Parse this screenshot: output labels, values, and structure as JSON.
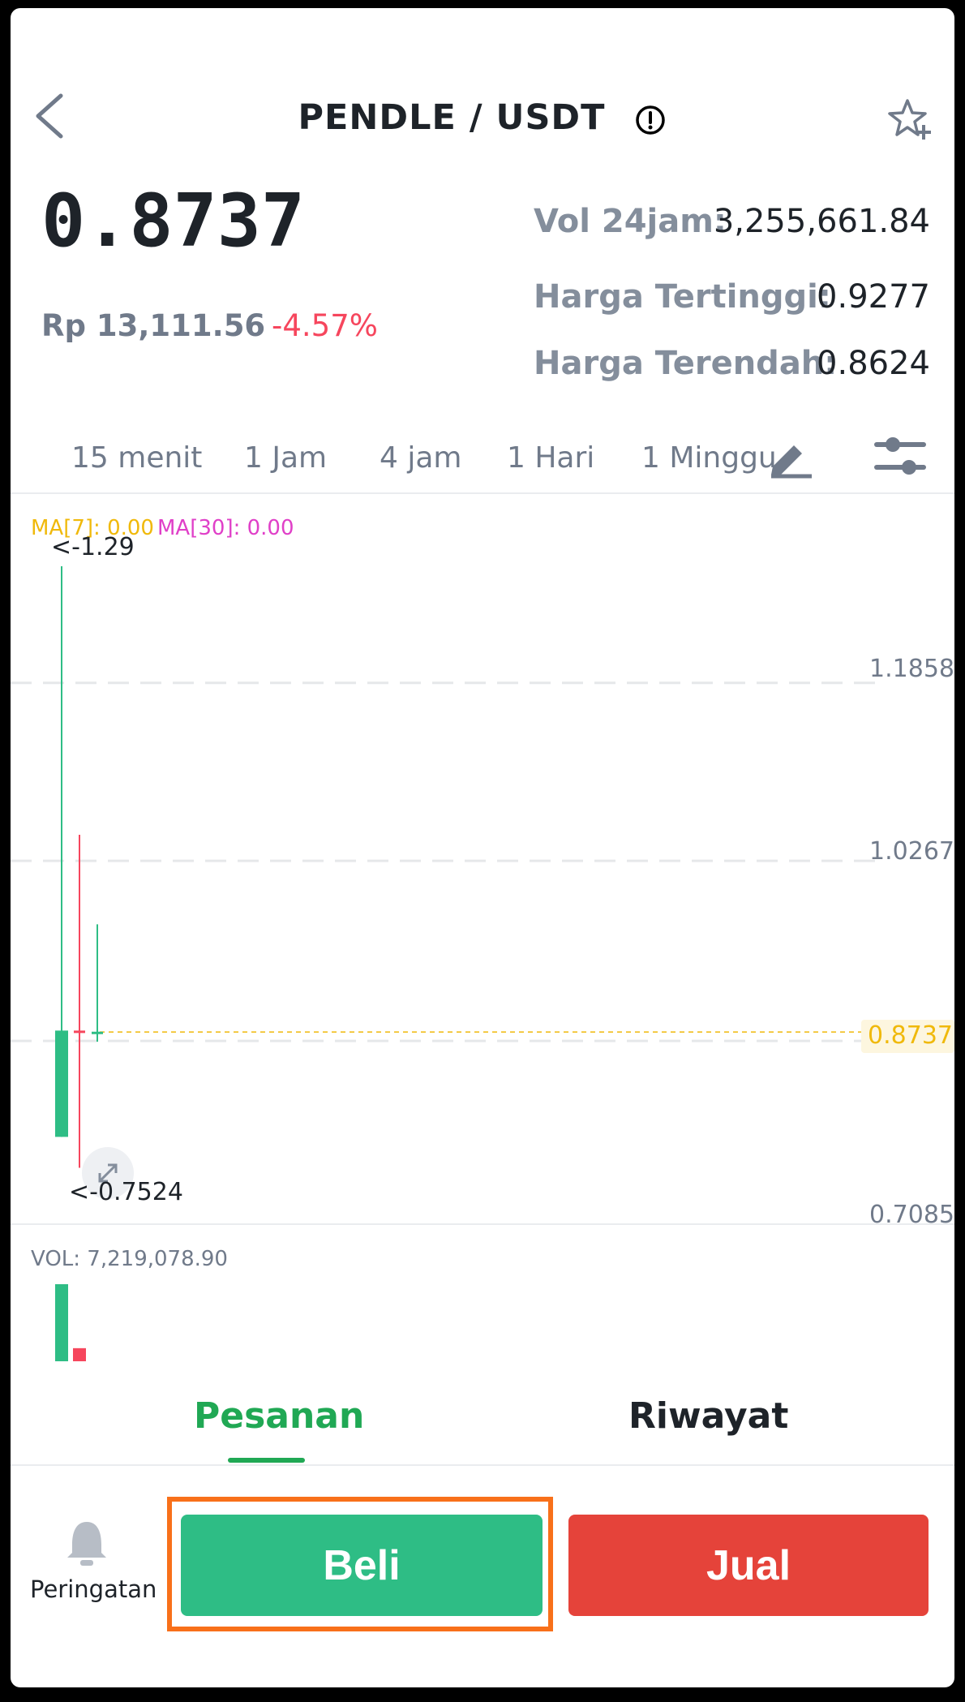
{
  "header": {
    "pair": "PENDLE / USDT"
  },
  "ticker": {
    "last_price": "0.8737",
    "price_idr": "Rp 13,111.56",
    "change_percent": "-4.57%",
    "vol_label": "Vol 24jam:",
    "vol_value": "3,255,661.84",
    "high_label": "Harga Tertinggi:",
    "high_value": "0.9277",
    "low_label": "Harga Terendah:",
    "low_value": "0.8624"
  },
  "intervals": [
    "15 menit",
    "1 Jam",
    "4 jam",
    "1 Hari",
    "1 Minggu"
  ],
  "chart": {
    "ma7": "MA[7]: 0.00",
    "ma30": "MA[30]: 0.00",
    "max_marker": "<-1.29",
    "min_marker": "<-0.7524",
    "axis_labels": [
      "1.1858",
      "1.0267",
      "0.8737",
      "0.7085"
    ],
    "vol_label": "VOL: 7,219,078.90"
  },
  "chart_data": {
    "type": "candlestick",
    "ylim": [
      0.7085,
      1.29
    ],
    "candles": [
      {
        "open": 0.78,
        "close": 0.875,
        "high": 1.29,
        "low": 0.78,
        "color": "#2ebd85"
      },
      {
        "open": 0.875,
        "close": 0.874,
        "high": 1.05,
        "low": 0.7524,
        "color": "#f6465d"
      },
      {
        "open": 0.873,
        "close": 0.874,
        "high": 0.97,
        "low": 0.865,
        "color": "#2ebd85"
      }
    ],
    "volumes": [
      {
        "value": 1.0,
        "color": "#2ebd85"
      },
      {
        "value": 0.17,
        "color": "#f6465d"
      }
    ]
  },
  "bottom_tabs": {
    "orders": "Pesanan",
    "history": "Riwayat"
  },
  "actions": {
    "alert_label": "Peringatan",
    "buy_label": "Beli",
    "sell_label": "Jual"
  },
  "colors": {
    "buy": "#2ebd85",
    "sell": "#e5433a",
    "accent_tab": "#20a854",
    "highlight": "#f8701a"
  }
}
